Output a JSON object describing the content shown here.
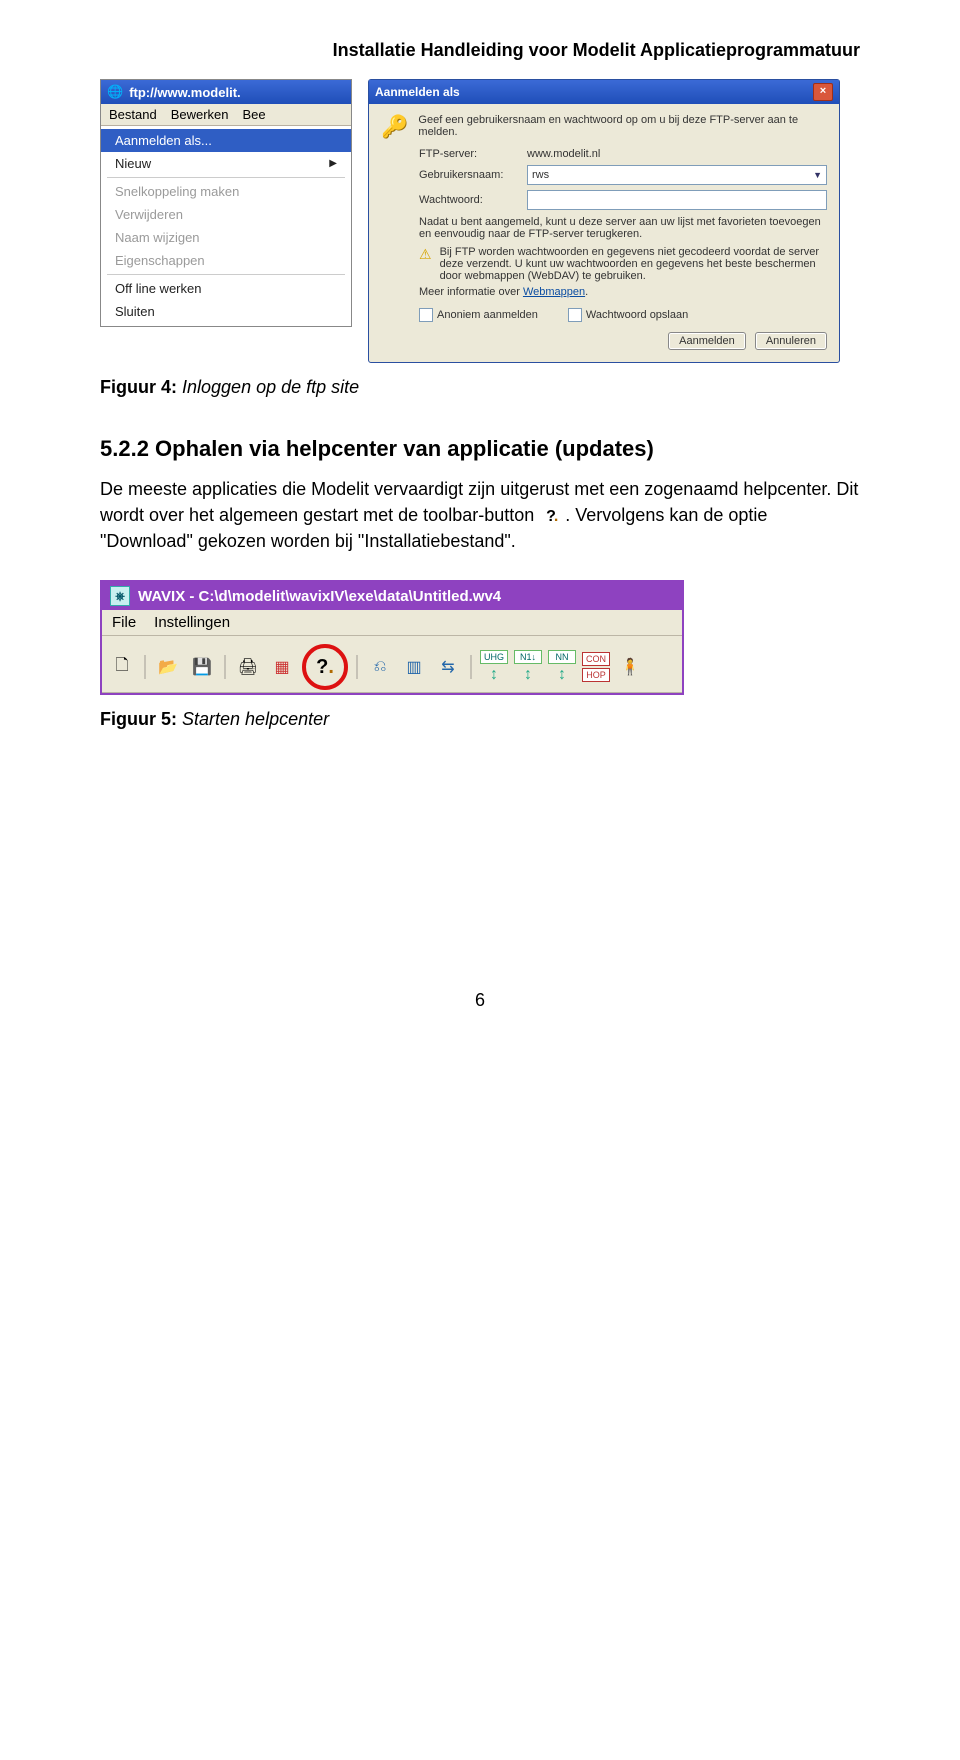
{
  "header": {
    "title": "Installatie Handleiding voor Modelit Applicatieprogrammatuur"
  },
  "ctx": {
    "titlebar_url": "ftp://www.modelit.",
    "menubar": {
      "bestand": "Bestand",
      "bewerken": "Bewerken",
      "bee": "Bee"
    },
    "items": {
      "aanmelden": "Aanmelden als...",
      "nieuw": "Nieuw",
      "snelkoppeling": "Snelkoppeling maken",
      "verwijderen": "Verwijderen",
      "naam": "Naam wijzigen",
      "eigenschappen": "Eigenschappen",
      "offline": "Off line werken",
      "sluiten": "Sluiten"
    }
  },
  "dlg": {
    "title": "Aanmelden als",
    "intro": "Geef een gebruikersnaam en wachtwoord op om u bij deze FTP-server aan te melden.",
    "ftp_label": "FTP-server:",
    "ftp_value": "www.modelit.nl",
    "user_label": "Gebruikersnaam:",
    "user_value": "rws",
    "pass_label": "Wachtwoord:",
    "msg1": "Nadat u bent aangemeld, kunt u deze server aan uw lijst met favorieten toevoegen en eenvoudig naar de FTP-server terugkeren.",
    "msg2a": "Bij FTP worden wachtwoorden en gegevens niet gecodeerd voordat de server deze verzendt. U kunt uw wachtwoorden en gegevens het beste beschermen door webmappen (WebDAV) te gebruiken.",
    "moreinfo_pre": "Meer informatie over ",
    "moreinfo_link": "Webmappen",
    "chk_anon": "Anoniem aanmelden",
    "chk_save": "Wachtwoord opslaan",
    "btn_login": "Aanmelden",
    "btn_cancel": "Annuleren"
  },
  "fig4": {
    "label": "Figuur 4:",
    "text": "Inloggen op de ftp site"
  },
  "section": {
    "heading": "5.2.2  Ophalen via helpcenter van applicatie (updates)",
    "para_pre": "De meeste applicaties die Modelit vervaardigt zijn uitgerust met een zogenaamd helpcenter. Dit wordt over het algemeen gestart met de toolbar-button ",
    "para_post": ". Vervolgens kan de optie \"Download\" gekozen worden bij \"Installatiebestand\"."
  },
  "wavix": {
    "title": "WAVIX - C:\\d\\modelit\\wavixIV\\exe\\data\\Untitled.wv4",
    "menu": {
      "file": "File",
      "inst": "Instellingen"
    },
    "labels": {
      "uhg": "UHG",
      "n1": "N1↓",
      "nn": "NN",
      "con": "CON",
      "hop": "HOP"
    }
  },
  "fig5": {
    "label": "Figuur 5:",
    "text": "Starten helpcenter"
  },
  "pagenum": "6"
}
